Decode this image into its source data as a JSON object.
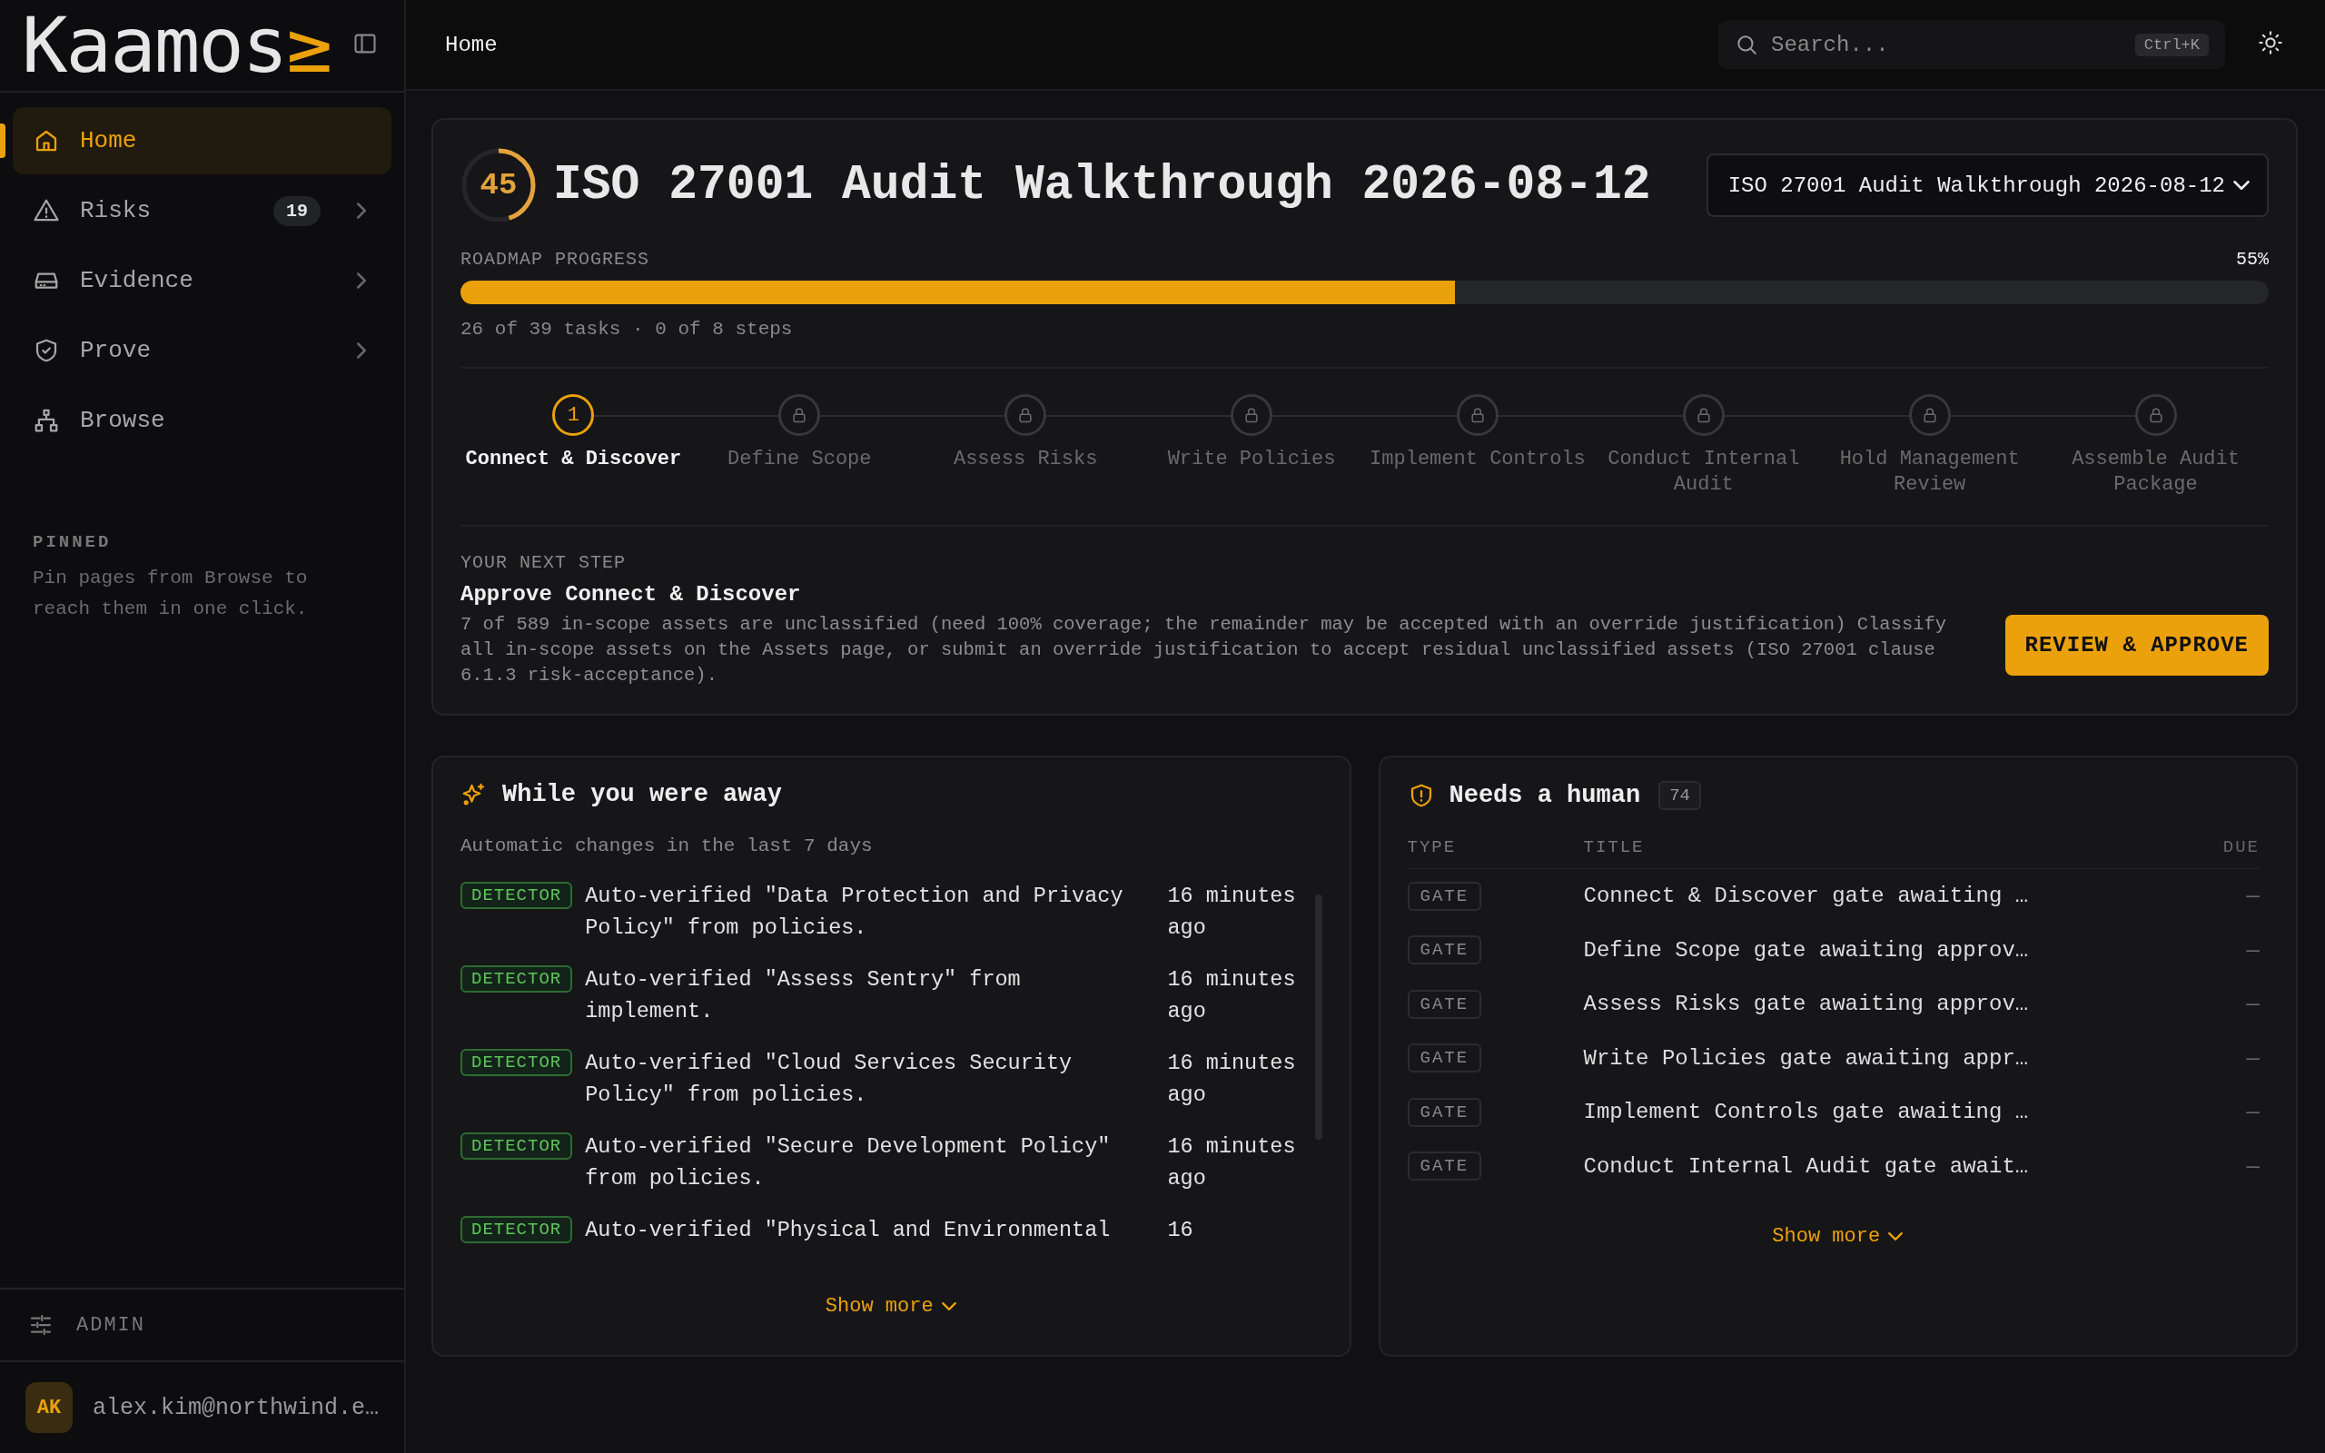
{
  "sidebar": {
    "logo": {
      "text": "Kaamos",
      "mark": "≥"
    },
    "nav": [
      {
        "label": "Home",
        "selected": true,
        "expandable": false
      },
      {
        "label": "Risks",
        "badge": "19",
        "selected": false,
        "expandable": true
      },
      {
        "label": "Evidence",
        "selected": false,
        "expandable": true
      },
      {
        "label": "Prove",
        "selected": false,
        "expandable": true
      },
      {
        "label": "Browse",
        "selected": false,
        "expandable": false
      }
    ],
    "pinned": {
      "heading": "PINNED",
      "empty_text": "Pin pages from Browse to reach them in one click."
    },
    "admin": {
      "label": "ADMIN"
    },
    "user": {
      "initials": "AK",
      "email": "alex.kim@northwind.e…"
    }
  },
  "header": {
    "breadcrumb": "Home",
    "search": {
      "placeholder": "Search...",
      "shortcut": "Ctrl+K"
    }
  },
  "roadmap": {
    "score": {
      "value": "45",
      "level": 0.45
    },
    "title": "ISO 27001 Audit Walkthrough 2026-08-12",
    "selector": {
      "value": "ISO 27001 Audit Walkthrough 2026-08-12"
    },
    "progress": {
      "label": "ROADMAP PROGRESS",
      "percent": "55%",
      "level": 0.55,
      "summary": "26 of 39 tasks · 0 of 8 steps"
    },
    "steps": [
      {
        "label": "Connect & Discover",
        "number": "1",
        "kind": "current"
      },
      {
        "label": "Define Scope",
        "kind": "locked"
      },
      {
        "label": "Assess Risks",
        "kind": "locked"
      },
      {
        "label": "Write Policies",
        "kind": "locked"
      },
      {
        "label": "Implement Controls",
        "kind": "locked"
      },
      {
        "label": "Conduct Internal Audit",
        "kind": "locked"
      },
      {
        "label": "Hold Management Review",
        "kind": "locked"
      },
      {
        "label": "Assemble Audit Package",
        "kind": "locked"
      }
    ],
    "next_step": {
      "heading": "YOUR NEXT STEP",
      "title": "Approve Connect & Discover",
      "description": "7 of 589 in-scope assets are unclassified (need 100% coverage; the remainder may be accepted with an override justification) Classify all in-scope assets on the Assets page, or submit an override justification to accept residual unclassified assets (ISO 27001 clause 6.1.3 risk-acceptance).",
      "button": "REVIEW & APPROVE"
    }
  },
  "activity": {
    "title": "While you were away",
    "subtitle": "Automatic changes in the last 7 days",
    "items": [
      {
        "tag": "DETECTOR",
        "text": "Auto-verified \"Data Protection and Privacy Policy\" from policies.",
        "time": "16 minutes ago"
      },
      {
        "tag": "DETECTOR",
        "text": "Auto-verified \"Assess Sentry\" from implement.",
        "time": "16 minutes ago"
      },
      {
        "tag": "DETECTOR",
        "text": "Auto-verified \"Cloud Services Security Policy\" from policies.",
        "time": "16 minutes ago"
      },
      {
        "tag": "DETECTOR",
        "text": "Auto-verified \"Secure Development Policy\" from policies.",
        "time": "16 minutes ago"
      },
      {
        "tag": "DETECTOR",
        "text": "Auto-verified \"Physical and Environmental",
        "time": "16"
      }
    ],
    "show_more": "Show more"
  },
  "needs_human": {
    "title": "Needs a human",
    "count": "74",
    "columns": [
      "TYPE",
      "TITLE",
      "DUE"
    ],
    "rows": [
      {
        "type": "GATE",
        "title": "Connect & Discover gate awaiting …",
        "due": "—"
      },
      {
        "type": "GATE",
        "title": "Define Scope gate awaiting approv…",
        "due": "—"
      },
      {
        "type": "GATE",
        "title": "Assess Risks gate awaiting approv…",
        "due": "—"
      },
      {
        "type": "GATE",
        "title": "Write Policies gate awaiting appr…",
        "due": "—"
      },
      {
        "type": "GATE",
        "title": "Implement Controls gate awaiting …",
        "due": "—"
      },
      {
        "type": "GATE",
        "title": "Conduct Internal Audit gate await…",
        "due": "—"
      }
    ],
    "show_more": "Show more"
  }
}
